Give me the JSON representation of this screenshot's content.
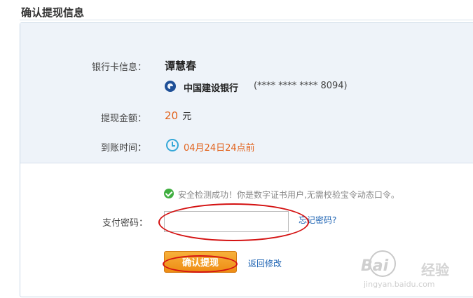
{
  "page": {
    "title": "确认提现信息"
  },
  "card": {
    "label": "银行卡信息：",
    "holder": "谭慧春",
    "bank_name": "中国建设银行",
    "card_number": "(**** **** **** 8094)"
  },
  "amount": {
    "label": "提现金额：",
    "value": "20",
    "unit": "元"
  },
  "arrival": {
    "label": "到账时间：",
    "value": "04月24日24点前"
  },
  "security": {
    "message": "安全检测成功！你是数字证书用户,无需校验宝令动态口令。"
  },
  "password": {
    "label": "支付密码：",
    "value": "",
    "forgot_link": "忘记密码?"
  },
  "actions": {
    "confirm": "确认提现",
    "back": "返回修改"
  },
  "watermark": {
    "logo": "Bai",
    "logo_tail": "经验",
    "url": "jingyan.baidu.com"
  },
  "colors": {
    "accent": "#e2621b",
    "link": "#1d63b3",
    "button": "#ee8c14",
    "annotation": "#d41212",
    "panel": "#eef3f9"
  },
  "icons": {
    "bank": "ccb-logo-icon",
    "clock": "alarm-clock-icon",
    "check": "check-circle-icon"
  }
}
